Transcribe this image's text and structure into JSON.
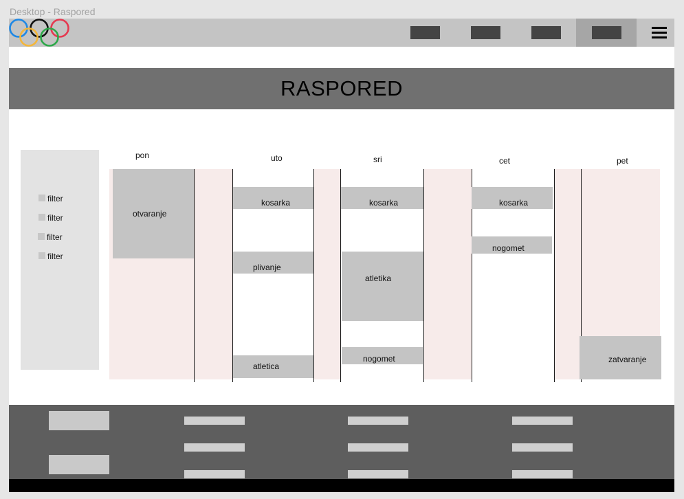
{
  "window": {
    "title": "Desktop - Raspored"
  },
  "header": {
    "logo_icon": "olympic-rings-icon",
    "ring_colors": [
      "#1e88e5",
      "#111111",
      "#e53950",
      "#f4b63a",
      "#2ea84a"
    ],
    "menu_icon": "hamburger-menu-icon"
  },
  "banner": {
    "title": "RASPORED"
  },
  "filters": {
    "items": [
      {
        "label": "filter"
      },
      {
        "label": "filter"
      },
      {
        "label": "filter"
      },
      {
        "label": "filter"
      }
    ]
  },
  "schedule": {
    "days": [
      {
        "label": "pon"
      },
      {
        "label": "uto"
      },
      {
        "label": "sri"
      },
      {
        "label": "cet"
      },
      {
        "label": "pet"
      }
    ],
    "events": {
      "pon": [
        "otvaranje"
      ],
      "uto": [
        "kosarka",
        "plivanje",
        "atletica"
      ],
      "sri": [
        "kosarka",
        "atletika",
        "nogomet"
      ],
      "cet": [
        "kosarka",
        "nogomet"
      ],
      "pet": [
        "zatvaranje"
      ]
    }
  }
}
